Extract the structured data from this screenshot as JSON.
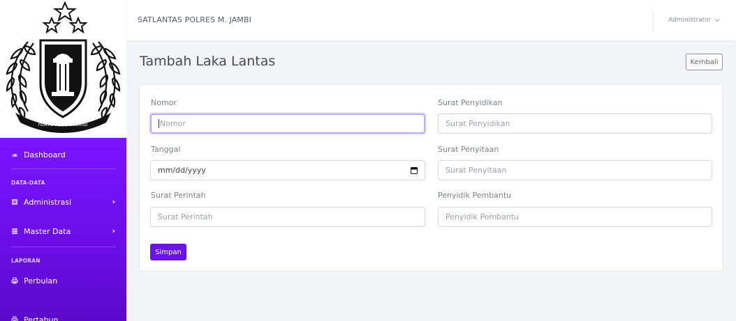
{
  "topbar": {
    "brand": "SATLANTAS POLRES M. JAMBI",
    "user": "Administrator"
  },
  "logo": {
    "motto": "rastra sewakottama"
  },
  "sidebar": {
    "dashboard": "Dashboard",
    "heading_data": "DATA-DATA",
    "administrasi": "Administrasi",
    "master_data": "Master Data",
    "heading_laporan": "LAPORAN",
    "perbulan": "Perbulan",
    "pertahun": "Pertahun"
  },
  "page": {
    "title": "Tambah Laka Lantas",
    "back_label": "Kembali"
  },
  "form": {
    "nomor": {
      "label": "Nomor",
      "placeholder": "Nomor"
    },
    "tanggal": {
      "label": "Tanggal",
      "placeholder": "mm/dd/yyyy"
    },
    "surat_perintah": {
      "label": "Surat Perintah",
      "placeholder": "Surat Perintah"
    },
    "surat_penyidikan": {
      "label": "Surat Penyidikan",
      "placeholder": "Surat Penyidikan"
    },
    "surat_penyitaan": {
      "label": "Surat Penyitaan",
      "placeholder": "Surat Penyitaan"
    },
    "penyidik_pembantu": {
      "label": "Penyidik Pembantu",
      "placeholder": "Penyidik Pembantu"
    },
    "submit_label": "Simpan"
  },
  "colors": {
    "sidebar_gradient_top": "#7a14ff",
    "sidebar_gradient_bottom": "#5a09c9",
    "primary_button": "#6a13e6"
  }
}
